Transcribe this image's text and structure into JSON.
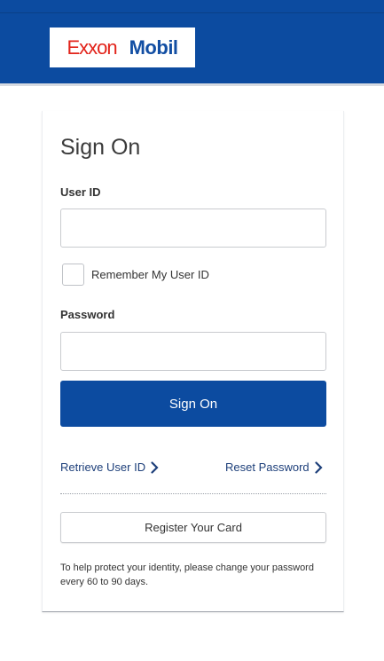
{
  "header": {
    "brand_left": "Exxon",
    "brand_right": "Mobil"
  },
  "signon": {
    "title": "Sign On",
    "user_id_label": "User ID",
    "user_id_value": "",
    "remember_label": "Remember My User ID",
    "remember_checked": false,
    "password_label": "Password",
    "password_value": "",
    "submit_label": "Sign On",
    "retrieve_link": "Retrieve User ID",
    "reset_link": "Reset Password",
    "register_label": "Register Your Card",
    "note": "To help protect your identity, please change your password every 60 to 90 days."
  },
  "colors": {
    "header_blue": "#0c4ba0",
    "exxon_red": "#e2231a",
    "mobil_blue": "#124ea3"
  },
  "icons": {
    "link_chevron": "chevron-right-icon"
  }
}
